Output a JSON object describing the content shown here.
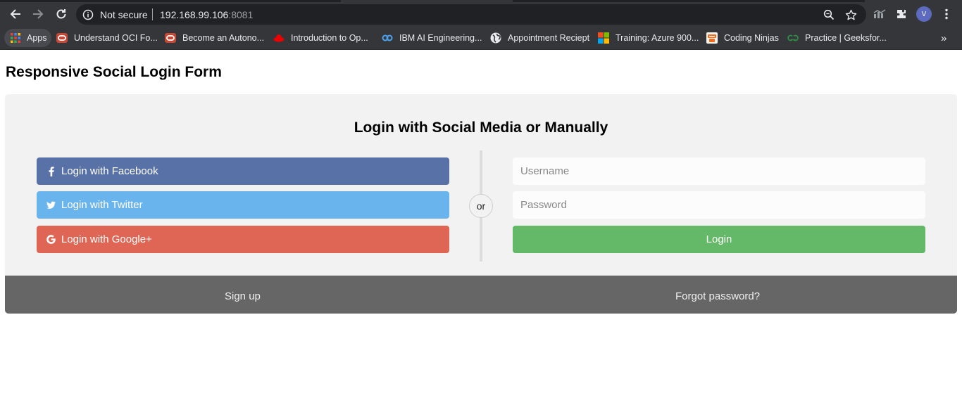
{
  "browser": {
    "omnibox": {
      "security_label": "Not secure",
      "host": "192.168.99.106",
      "port": ":8081"
    },
    "profile_initial": "V",
    "bookmarks": [
      {
        "label": "Apps",
        "icon": "apps-grid-icon"
      },
      {
        "label": "Understand OCI Fo...",
        "icon": "oracle-icon"
      },
      {
        "label": "Become an Autono...",
        "icon": "oracle-icon"
      },
      {
        "label": "Introduction to Op...",
        "icon": "redhat-icon"
      },
      {
        "label": "IBM AI Engineering...",
        "icon": "coursera-icon"
      },
      {
        "label": "Appointment Reciept",
        "icon": "globe-icon"
      },
      {
        "label": "Training: Azure 900...",
        "icon": "microsoft-icon"
      },
      {
        "label": "Coding Ninjas",
        "icon": "coding-ninjas-icon"
      },
      {
        "label": "Practice | Geeksfor...",
        "icon": "geeksforgeeks-icon"
      }
    ],
    "bookmarks_overflow": "»"
  },
  "page": {
    "title": "Responsive Social Login Form",
    "heading": "Login with Social Media or Manually",
    "social": {
      "facebook_label": "Login with Facebook",
      "twitter_label": "Login with Twitter",
      "google_label": "Login with Google+"
    },
    "divider_label": "or",
    "form": {
      "username_placeholder": "Username",
      "password_placeholder": "Password",
      "submit_label": "Login"
    },
    "footer": {
      "signup_label": "Sign up",
      "forgot_label": "Forgot password?"
    }
  },
  "colors": {
    "facebook": "#5872a8",
    "twitter": "#6ab4ee",
    "google": "#df6654",
    "login": "#63b967",
    "footer": "#666666",
    "panel": "#f2f2f2"
  }
}
